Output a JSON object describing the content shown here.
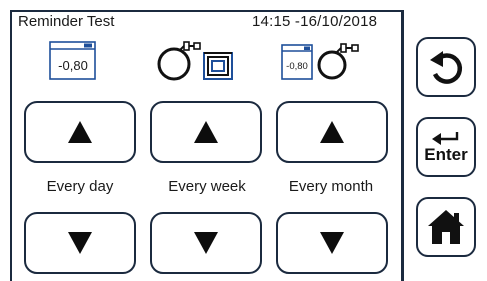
{
  "header": {
    "title": "Reminder Test",
    "datetime": "14:15 -16/10/2018"
  },
  "icons": {
    "daily": {
      "name": "meter-display-icon",
      "reading": "-0,80"
    },
    "weekly": {
      "name": "fiber-spool-icon"
    },
    "monthly": {
      "name": "meter-fiber-icon",
      "reading": "-0,80"
    }
  },
  "columns": [
    {
      "label": "Every day",
      "up_icon": "arrow-up-icon",
      "down_icon": "arrow-down-icon"
    },
    {
      "label": "Every week",
      "up_icon": "arrow-up-icon",
      "down_icon": "arrow-down-icon"
    },
    {
      "label": "Every month",
      "up_icon": "arrow-up-icon",
      "down_icon": "arrow-down-icon"
    }
  ],
  "side": {
    "back_icon": "back-arrow-icon",
    "enter_label": "Enter",
    "enter_icon": "enter-return-icon",
    "home_icon": "home-icon"
  },
  "colors": {
    "frame": "#1b2a3f",
    "icon_blue": "#1e4f9a",
    "arrow": "#0d0d0d"
  }
}
